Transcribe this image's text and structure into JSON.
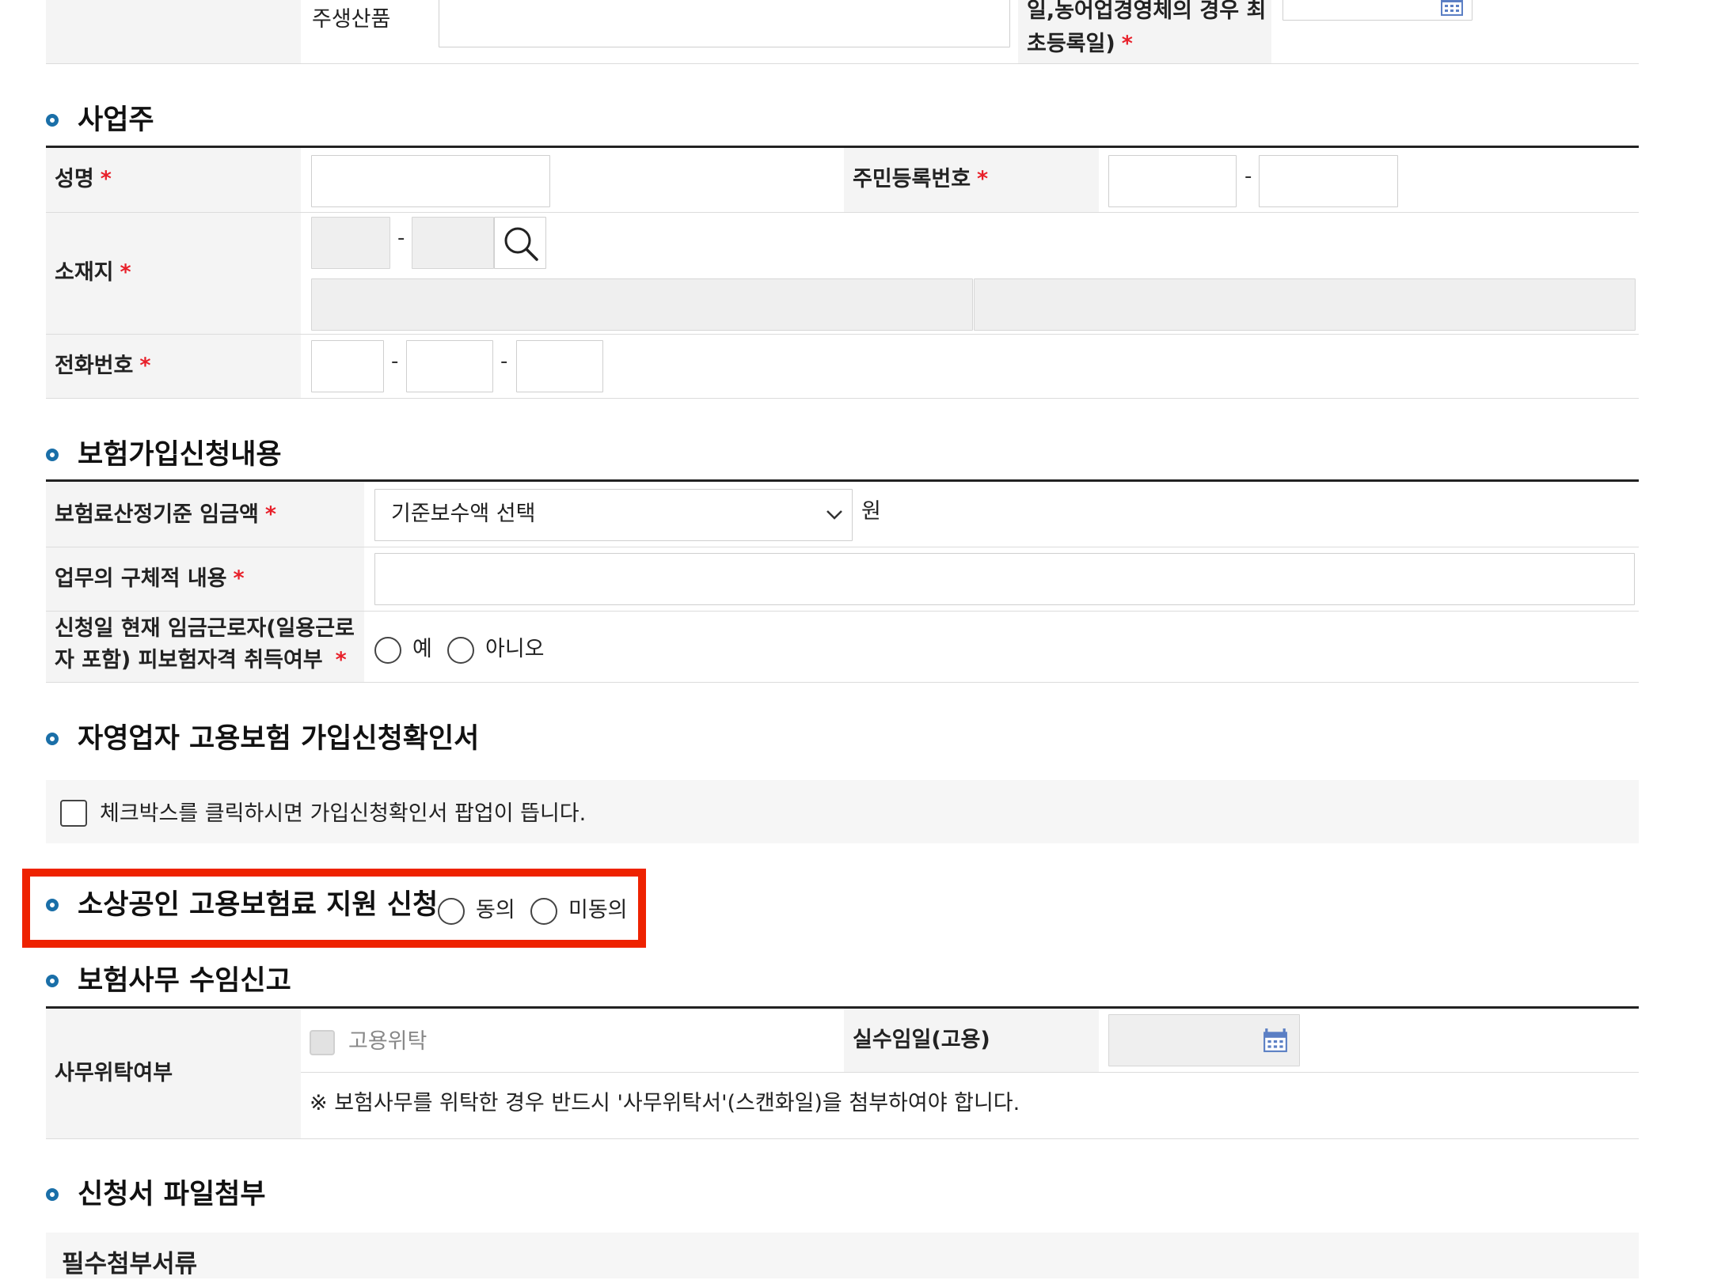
{
  "business_info": {
    "main_product_label": "주생산품",
    "start_date_label_line1": "일,농어업경영체의 경우 최",
    "start_date_label_line2": "초등록일)",
    "required_mark": "*"
  },
  "owner_section": {
    "title": "사업주",
    "name_label": "성명",
    "rrn_label": "주민등록번호",
    "address_label": "소재지",
    "phone_label": "전화번호",
    "dash": "-"
  },
  "insurance_section": {
    "title": "보험가입신청내용",
    "wage_label": "보험료산정기준 임금액",
    "wage_select_value": "기준보수액 선택",
    "wage_unit": "원",
    "job_label": "업무의 구체적 내용",
    "worker_label_line1": "신청일 현재 임금근로자(일용근로",
    "worker_label_line2": "자 포함) 피보험자격 취득여부",
    "worker_options": [
      "예",
      "아니오"
    ]
  },
  "confirmation_section": {
    "title": "자영업자 고용보험 가입신청확인서",
    "checkbox_text": "체크박스를 클릭하시면 가입신청확인서 팝업이 뜹니다."
  },
  "support_section": {
    "title": "소상공인 고용보험료 지원 신청",
    "options": [
      "동의",
      "미동의"
    ],
    "highlight_color": "#ee2200"
  },
  "agency_section": {
    "title": "보험사무 수임신고",
    "delegation_label": "사무위탁여부",
    "delegation_checkbox_label": "고용위탁",
    "actual_date_label": "실수임일(고용)",
    "note": "※ 보험사무를 위탁한 경우 반드시 '사무위탁서'(스캔화일)을 첨부하여야 합니다."
  },
  "file_section": {
    "title": "신청서 파일첨부",
    "required_docs_label": "필수첨부서류"
  },
  "colors": {
    "accent": "#1a6fa8",
    "required": "#e8202a",
    "calendar_icon": "#5b7fc4"
  }
}
